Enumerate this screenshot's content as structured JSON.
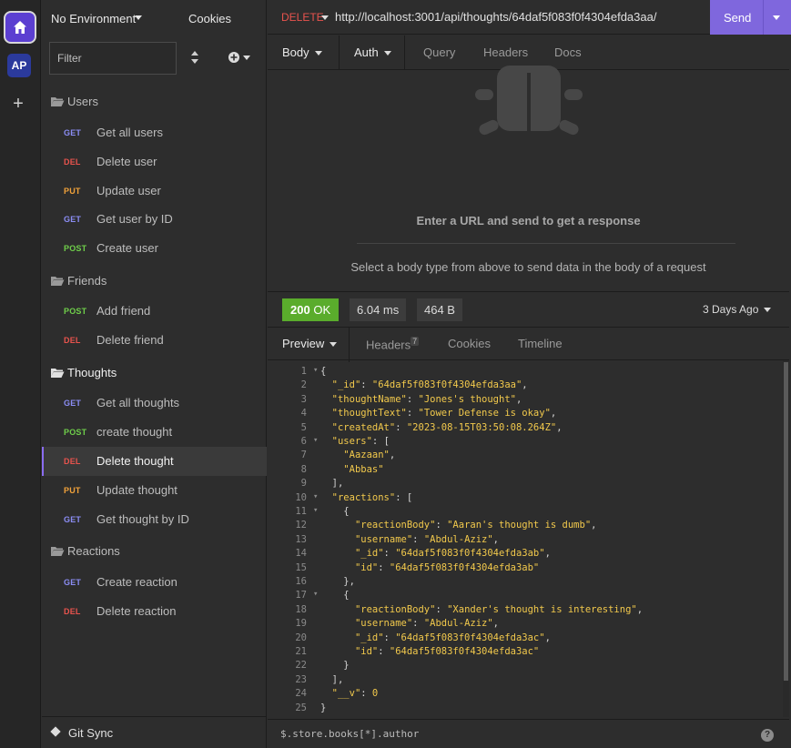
{
  "rail": {
    "workspace_initials": "AP",
    "icons": [
      "home-icon",
      "plus-icon"
    ],
    "accent": "#5b3fd1"
  },
  "sidebar": {
    "environment": "No Environment",
    "cookies_label": "Cookies",
    "filter_placeholder": "Filter",
    "groups": [
      {
        "name": "Users",
        "requests": [
          {
            "method": "GET",
            "label": "Get all users"
          },
          {
            "method": "DEL",
            "label": "Delete user"
          },
          {
            "method": "PUT",
            "label": "Update user"
          },
          {
            "method": "GET",
            "label": "Get user by ID"
          },
          {
            "method": "POST",
            "label": "Create user"
          }
        ]
      },
      {
        "name": "Friends",
        "requests": [
          {
            "method": "POST",
            "label": "Add friend"
          },
          {
            "method": "DEL",
            "label": "Delete friend"
          }
        ]
      },
      {
        "name": "Thoughts",
        "requests": [
          {
            "method": "GET",
            "label": "Get all thoughts"
          },
          {
            "method": "POST",
            "label": "create thought"
          },
          {
            "method": "DEL",
            "label": "Delete thought"
          },
          {
            "method": "PUT",
            "label": "Update thought"
          },
          {
            "method": "GET",
            "label": "Get thought by ID"
          }
        ]
      },
      {
        "name": "Reactions",
        "requests": [
          {
            "method": "GET",
            "label": "Create reaction"
          },
          {
            "method": "DEL",
            "label": "Delete reaction"
          }
        ]
      }
    ],
    "git_sync_label": "Git Sync"
  },
  "request": {
    "method": "DELETE",
    "url": "http://localhost:3001/api/thoughts/64daf5f083f0f4304efda3aa/",
    "send_label": "Send",
    "tabs": {
      "body": "Body",
      "auth": "Auth",
      "query": "Query",
      "headers": "Headers",
      "docs": "Docs"
    },
    "empty_title": "Enter a URL and send to get a response",
    "empty_hint": "Select a body type from above to send data in the body of a request"
  },
  "response": {
    "status_code": "200",
    "status_text": "OK",
    "time": "6.04 ms",
    "size": "464 B",
    "time_ago": "3 Days Ago",
    "tabs": {
      "preview": "Preview",
      "headers": "Headers",
      "headers_count": "7",
      "cookies": "Cookies",
      "timeline": "Timeline"
    },
    "lines": [
      "{",
      "  \"_id\": \"64daf5f083f0f4304efda3aa\",",
      "  \"thoughtName\": \"Jones's thought\",",
      "  \"thoughtText\": \"Tower Defense is okay\",",
      "  \"createdAt\": \"2023-08-15T03:50:08.264Z\",",
      "  \"users\": [",
      "    \"Aazaan\",",
      "    \"Abbas\"",
      "  ],",
      "  \"reactions\": [",
      "    {",
      "      \"reactionBody\": \"Aaran's thought is dumb\",",
      "      \"username\": \"Abdul-Aziz\",",
      "      \"_id\": \"64daf5f083f0f4304efda3ab\",",
      "      \"id\": \"64daf5f083f0f4304efda3ab\"",
      "    },",
      "    {",
      "      \"reactionBody\": \"Xander's thought is interesting\",",
      "      \"username\": \"Abdul-Aziz\",",
      "      \"_id\": \"64daf5f083f0f4304efda3ac\",",
      "      \"id\": \"64daf5f083f0f4304efda3ac\"",
      "    }",
      "  ],",
      "  \"__v\": 0",
      "}"
    ],
    "filter_expression": "$.store.books[*].author",
    "help_label": "?"
  },
  "colors": {
    "get": "#8b8df4",
    "del": "#e8534d",
    "put": "#f1a23a",
    "post": "#6fcf4a",
    "status_ok": "#5aac2c",
    "send": "#7f67dd"
  }
}
